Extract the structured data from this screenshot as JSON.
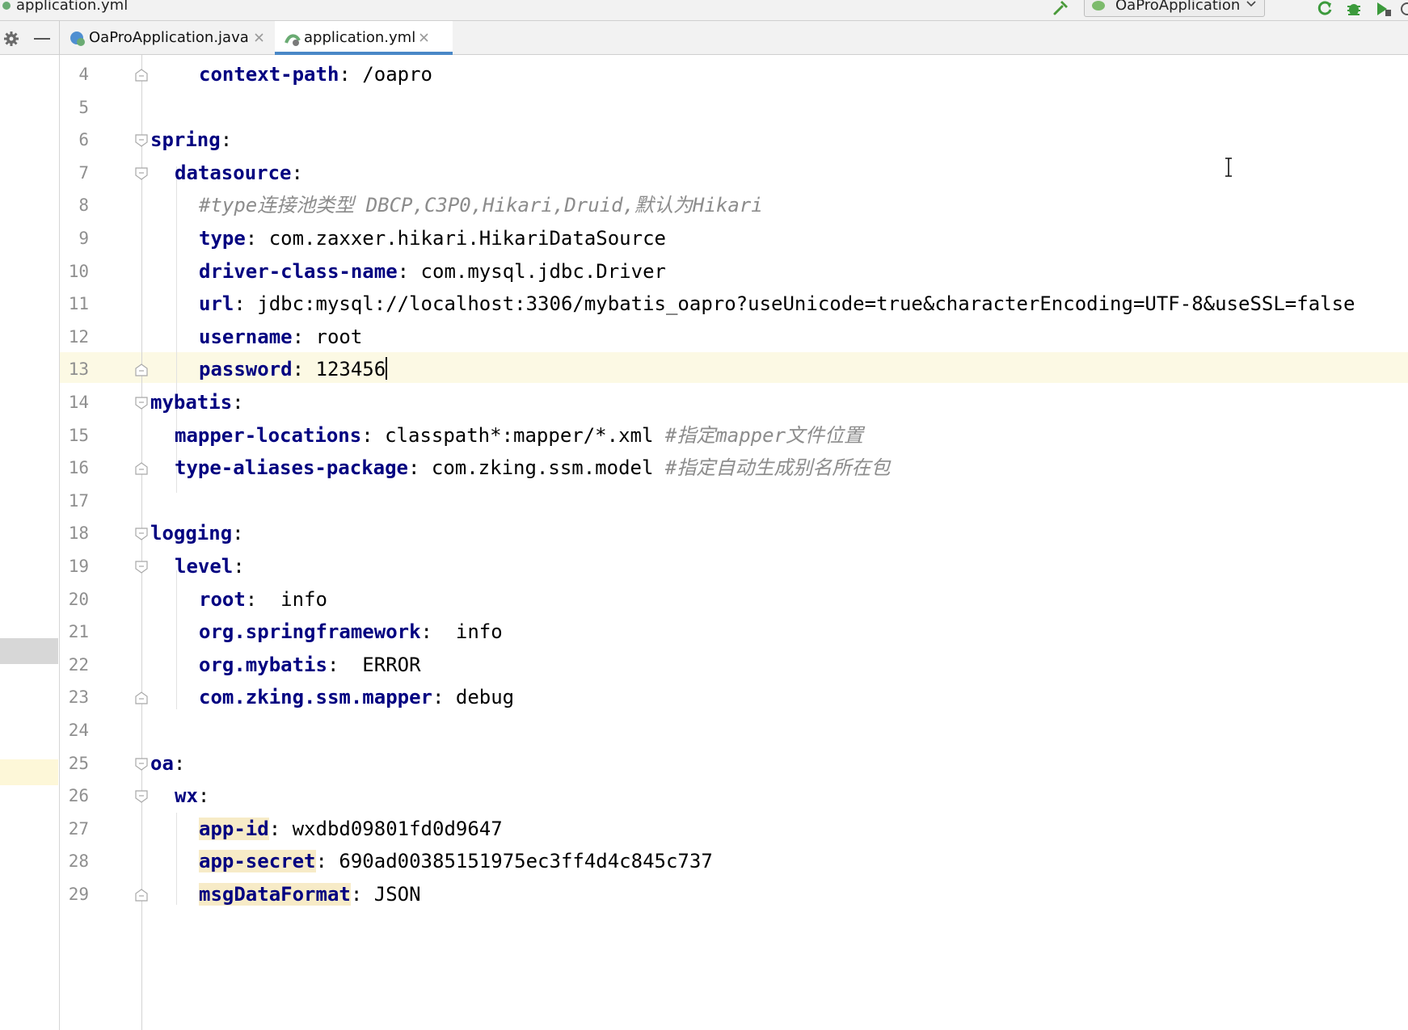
{
  "window": {
    "title": "application.yml",
    "run_config": "OaProApplication",
    "toolbar_icons": [
      "build-hammer-icon",
      "rerun-icon",
      "debug-icon",
      "coverage-icon",
      "profile-icon"
    ]
  },
  "tabs": [
    {
      "label": "OaProApplication.java",
      "icon": "java-spring-class-icon",
      "active": false
    },
    {
      "label": "application.yml",
      "icon": "yaml-spring-icon",
      "active": true
    }
  ],
  "editor": {
    "lines": [
      {
        "n": "4",
        "indent": 2,
        "fold": "end",
        "key": "context-path",
        "value": " /oapro"
      },
      {
        "n": "5",
        "indent": 0,
        "fold": "",
        "key": "",
        "value": ""
      },
      {
        "n": "6",
        "indent": 0,
        "fold": "start",
        "key": "spring",
        "value": ""
      },
      {
        "n": "7",
        "indent": 1,
        "fold": "start",
        "key": "datasource",
        "value": ""
      },
      {
        "n": "8",
        "indent": 2,
        "fold": "",
        "comment": "#type连接池类型 DBCP,C3P0,Hikari,Druid,默认为Hikari"
      },
      {
        "n": "9",
        "indent": 2,
        "fold": "",
        "key": "type",
        "value": " com.zaxxer.hikari.HikariDataSource"
      },
      {
        "n": "10",
        "indent": 2,
        "fold": "",
        "key": "driver-class-name",
        "value": " com.mysql.jdbc.Driver"
      },
      {
        "n": "11",
        "indent": 2,
        "fold": "",
        "key": "url",
        "value": " jdbc:mysql://localhost:3306/mybatis_oapro?useUnicode=true&characterEncoding=UTF-8&useSSL=false"
      },
      {
        "n": "12",
        "indent": 2,
        "fold": "",
        "key": "username",
        "value": " root"
      },
      {
        "n": "13",
        "indent": 2,
        "fold": "end",
        "key": "password",
        "value": " 123456",
        "cursor": true
      },
      {
        "n": "14",
        "indent": 0,
        "fold": "start",
        "key": "mybatis",
        "value": ""
      },
      {
        "n": "15",
        "indent": 1,
        "fold": "",
        "key": "mapper-locations",
        "value": " classpath*:mapper/*.xml ",
        "comment": "#指定mapper文件位置"
      },
      {
        "n": "16",
        "indent": 1,
        "fold": "end",
        "key": "type-aliases-package",
        "value": " com.zking.ssm.model ",
        "comment": "#指定自动生成别名所在包"
      },
      {
        "n": "17",
        "indent": 0,
        "fold": "",
        "key": "",
        "value": ""
      },
      {
        "n": "18",
        "indent": 0,
        "fold": "start",
        "key": "logging",
        "value": ""
      },
      {
        "n": "19",
        "indent": 1,
        "fold": "start",
        "key": "level",
        "value": ""
      },
      {
        "n": "20",
        "indent": 2,
        "fold": "",
        "key": "root",
        "value": "  info"
      },
      {
        "n": "21",
        "indent": 2,
        "fold": "",
        "key": "org.springframework",
        "value": "  info"
      },
      {
        "n": "22",
        "indent": 2,
        "fold": "",
        "key": "org.mybatis",
        "value": "  ERROR"
      },
      {
        "n": "23",
        "indent": 2,
        "fold": "end",
        "key": "com.zking.ssm.mapper",
        "value": " debug"
      },
      {
        "n": "24",
        "indent": 0,
        "fold": "",
        "key": "",
        "value": ""
      },
      {
        "n": "25",
        "indent": 0,
        "fold": "start",
        "key": "oa",
        "value": ""
      },
      {
        "n": "26",
        "indent": 1,
        "fold": "start",
        "key": "wx",
        "value": ""
      },
      {
        "n": "27",
        "indent": 2,
        "fold": "",
        "key": "app-id",
        "value": " wxdbd09801fd0d9647",
        "highlight": true
      },
      {
        "n": "28",
        "indent": 2,
        "fold": "",
        "key": "app-secret",
        "value": " 690ad00385151975ec3ff4d4c845c737",
        "highlight": true
      },
      {
        "n": "29",
        "indent": 2,
        "fold": "end",
        "key": "msgDataFormat",
        "value": " JSON",
        "highlight": true
      }
    ]
  }
}
